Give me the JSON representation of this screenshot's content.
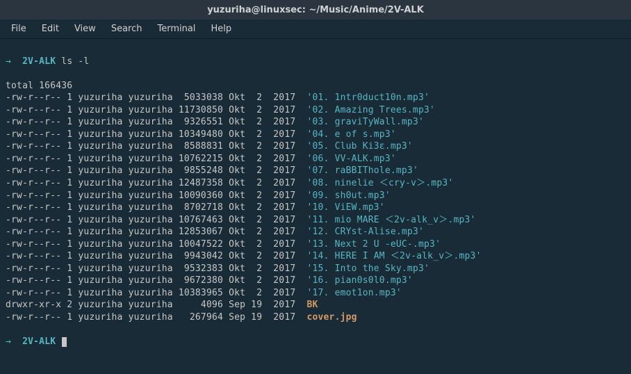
{
  "titlebar": {
    "title": "yuzuriha@linuxsec: ~/Music/Anime/2V-ALK"
  },
  "menu": {
    "items": [
      "File",
      "Edit",
      "View",
      "Search",
      "Terminal",
      "Help"
    ]
  },
  "prompt": {
    "arrow": "→",
    "cwd": "2V-ALK",
    "command": "ls -l"
  },
  "output": {
    "total_line": "total 166436",
    "rows": [
      {
        "perms": "-rw-r--r--",
        "links": "1",
        "owner": "yuzuriha",
        "group": "yuzuriha",
        "size": "5033038",
        "mon": "Okt",
        "day": "2",
        "year": "2017",
        "name": "'01. 1ntr0duct10n.mp3'",
        "kind": "file"
      },
      {
        "perms": "-rw-r--r--",
        "links": "1",
        "owner": "yuzuriha",
        "group": "yuzuriha",
        "size": "11730850",
        "mon": "Okt",
        "day": "2",
        "year": "2017",
        "name": "'02. Amazing Trees.mp3'",
        "kind": "file"
      },
      {
        "perms": "-rw-r--r--",
        "links": "1",
        "owner": "yuzuriha",
        "group": "yuzuriha",
        "size": "9326551",
        "mon": "Okt",
        "day": "2",
        "year": "2017",
        "name": "'03. graviTyWall.mp3'",
        "kind": "file"
      },
      {
        "perms": "-rw-r--r--",
        "links": "1",
        "owner": "yuzuriha",
        "group": "yuzuriha",
        "size": "10349480",
        "mon": "Okt",
        "day": "2",
        "year": "2017",
        "name": "'04. e of s.mp3'",
        "kind": "file"
      },
      {
        "perms": "-rw-r--r--",
        "links": "1",
        "owner": "yuzuriha",
        "group": "yuzuriha",
        "size": "8588831",
        "mon": "Okt",
        "day": "2",
        "year": "2017",
        "name": "'05. Club Ki3ε.mp3'",
        "kind": "file"
      },
      {
        "perms": "-rw-r--r--",
        "links": "1",
        "owner": "yuzuriha",
        "group": "yuzuriha",
        "size": "10762215",
        "mon": "Okt",
        "day": "2",
        "year": "2017",
        "name": "'06. VV-ALK.mp3'",
        "kind": "file"
      },
      {
        "perms": "-rw-r--r--",
        "links": "1",
        "owner": "yuzuriha",
        "group": "yuzuriha",
        "size": "9855248",
        "mon": "Okt",
        "day": "2",
        "year": "2017",
        "name": "'07. raBBIThole.mp3'",
        "kind": "file"
      },
      {
        "perms": "-rw-r--r--",
        "links": "1",
        "owner": "yuzuriha",
        "group": "yuzuriha",
        "size": "12487358",
        "mon": "Okt",
        "day": "2",
        "year": "2017",
        "name": "'08. ninelie ＜cry-v＞.mp3'",
        "kind": "file"
      },
      {
        "perms": "-rw-r--r--",
        "links": "1",
        "owner": "yuzuriha",
        "group": "yuzuriha",
        "size": "10090360",
        "mon": "Okt",
        "day": "2",
        "year": "2017",
        "name": "'09. sh0ut.mp3'",
        "kind": "file"
      },
      {
        "perms": "-rw-r--r--",
        "links": "1",
        "owner": "yuzuriha",
        "group": "yuzuriha",
        "size": "8702718",
        "mon": "Okt",
        "day": "2",
        "year": "2017",
        "name": "'10. ViEW.mp3'",
        "kind": "file"
      },
      {
        "perms": "-rw-r--r--",
        "links": "1",
        "owner": "yuzuriha",
        "group": "yuzuriha",
        "size": "10767463",
        "mon": "Okt",
        "day": "2",
        "year": "2017",
        "name": "'11. mio MARE ＜2v-alk_v＞.mp3'",
        "kind": "file"
      },
      {
        "perms": "-rw-r--r--",
        "links": "1",
        "owner": "yuzuriha",
        "group": "yuzuriha",
        "size": "12853067",
        "mon": "Okt",
        "day": "2",
        "year": "2017",
        "name": "'12. CRYst-Alise.mp3'",
        "kind": "file"
      },
      {
        "perms": "-rw-r--r--",
        "links": "1",
        "owner": "yuzuriha",
        "group": "yuzuriha",
        "size": "10047522",
        "mon": "Okt",
        "day": "2",
        "year": "2017",
        "name": "'13. Next 2 U -eUC-.mp3'",
        "kind": "file"
      },
      {
        "perms": "-rw-r--r--",
        "links": "1",
        "owner": "yuzuriha",
        "group": "yuzuriha",
        "size": "9943042",
        "mon": "Okt",
        "day": "2",
        "year": "2017",
        "name": "'14. HERE I AM ＜2v-alk_v＞.mp3'",
        "kind": "file"
      },
      {
        "perms": "-rw-r--r--",
        "links": "1",
        "owner": "yuzuriha",
        "group": "yuzuriha",
        "size": "9532383",
        "mon": "Okt",
        "day": "2",
        "year": "2017",
        "name": "'15. Into the Sky.mp3'",
        "kind": "file"
      },
      {
        "perms": "-rw-r--r--",
        "links": "1",
        "owner": "yuzuriha",
        "group": "yuzuriha",
        "size": "9672380",
        "mon": "Okt",
        "day": "2",
        "year": "2017",
        "name": "'16. pian0s0l0.mp3'",
        "kind": "file"
      },
      {
        "perms": "-rw-r--r--",
        "links": "1",
        "owner": "yuzuriha",
        "group": "yuzuriha",
        "size": "10383965",
        "mon": "Okt",
        "day": "2",
        "year": "2017",
        "name": "'17. emot1on.mp3'",
        "kind": "file"
      },
      {
        "perms": "drwxr-xr-x",
        "links": "2",
        "owner": "yuzuriha",
        "group": "yuzuriha",
        "size": "4096",
        "mon": "Sep",
        "day": "19",
        "year": "2017",
        "name": "BK",
        "kind": "dir"
      },
      {
        "perms": "-rw-r--r--",
        "links": "1",
        "owner": "yuzuriha",
        "group": "yuzuriha",
        "size": "267964",
        "mon": "Sep",
        "day": "19",
        "year": "2017",
        "name": "cover.jpg",
        "kind": "bold"
      }
    ]
  }
}
